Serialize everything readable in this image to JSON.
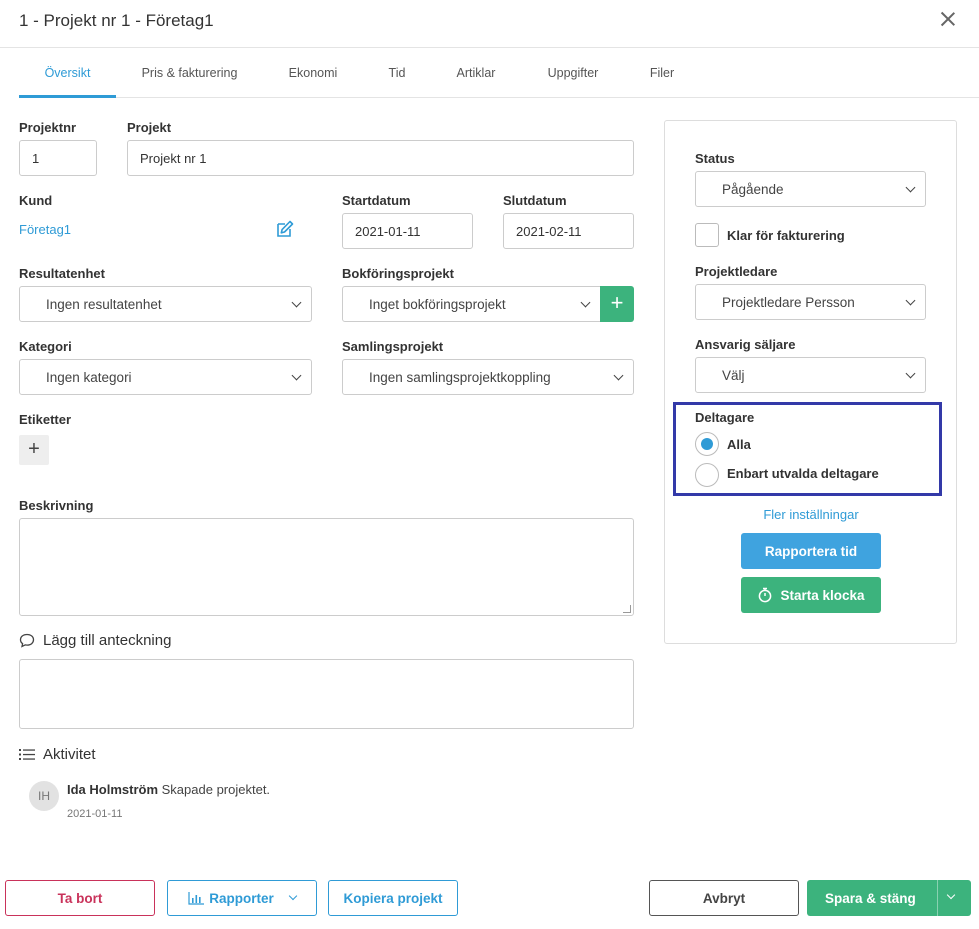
{
  "window": {
    "title": "1 - Projekt nr 1 - Företag1"
  },
  "tabs": [
    {
      "label": "Översikt",
      "active": true
    },
    {
      "label": "Pris & fakturering"
    },
    {
      "label": "Ekonomi"
    },
    {
      "label": "Tid"
    },
    {
      "label": "Artiklar"
    },
    {
      "label": "Uppgifter"
    },
    {
      "label": "Filer"
    }
  ],
  "form": {
    "projektnr_label": "Projektnr",
    "projektnr_value": "1",
    "projekt_label": "Projekt",
    "projekt_value": "Projekt nr 1",
    "kund_label": "Kund",
    "kund_value": "Företag1",
    "startdatum_label": "Startdatum",
    "startdatum_value": "2021-01-11",
    "slutdatum_label": "Slutdatum",
    "slutdatum_value": "2021-02-11",
    "resultatenhet_label": "Resultatenhet",
    "resultatenhet_value": "Ingen resultatenhet",
    "bokforingsprojekt_label": "Bokföringsprojekt",
    "bokforingsprojekt_value": "Inget bokföringsprojekt",
    "kategori_label": "Kategori",
    "kategori_value": "Ingen kategori",
    "samlingsprojekt_label": "Samlingsprojekt",
    "samlingsprojekt_value": "Ingen samlingsprojektkoppling",
    "etiketter_label": "Etiketter",
    "beskrivning_label": "Beskrivning"
  },
  "notes": {
    "heading": "Lägg till anteckning"
  },
  "activity": {
    "heading": "Aktivitet",
    "items": [
      {
        "initials": "IH",
        "user": "Ida Holmström",
        "text": "Skapade projektet.",
        "date": "2021-01-11"
      }
    ]
  },
  "sidebar": {
    "status_label": "Status",
    "status_value": "Pågående",
    "klar_label": "Klar för fakturering",
    "projektledare_label": "Projektledare",
    "projektledare_value": "Projektledare Persson",
    "saljare_label": "Ansvarig säljare",
    "saljare_value": "Välj",
    "deltagare_label": "Deltagare",
    "deltagare_options": [
      "Alla",
      "Enbart utvalda deltagare"
    ],
    "fler_link": "Fler inställningar",
    "rapportera_btn": "Rapportera tid",
    "starta_btn": "Starta klocka"
  },
  "footer": {
    "delete": "Ta bort",
    "reports": "Rapporter",
    "copy": "Kopiera projekt",
    "cancel": "Avbryt",
    "save": "Spara & stäng"
  },
  "colors": {
    "accent": "#2f9bd6",
    "success": "#3cb37d",
    "danger": "#c9325a",
    "highlight": "#3339a8"
  }
}
